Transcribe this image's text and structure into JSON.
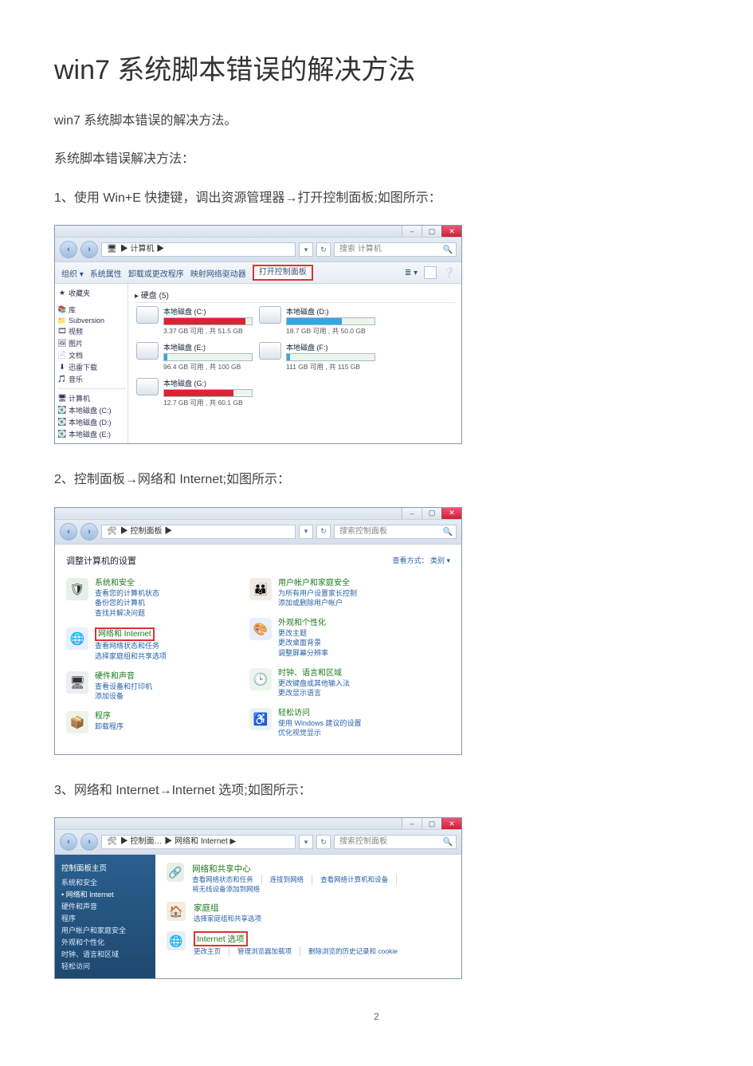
{
  "article": {
    "title": "win7 系统脚本错误的解决方法",
    "intro": "win7 系统脚本错误的解决方法。",
    "sub": "系统脚本错误解决方法：",
    "step1": "1、使用 Win+E 快捷键，调出资源管理器→打开控制面板;如图所示：",
    "step2": "2、控制面板→网络和 Internet;如图所示：",
    "step3": "3、网络和 Internet→Internet  选项;如图所示：",
    "page": "2"
  },
  "win_common": {
    "min": "–",
    "max": "▢",
    "close": "✕",
    "search_icon": "🔍",
    "back": "‹",
    "fwd": "›"
  },
  "img1": {
    "address": "▶  计算机  ▶",
    "search_placeholder": "搜索 计算机",
    "toolbar": {
      "a": "组织 ▾",
      "b": "系统属性",
      "c": "卸载或更改程序",
      "d": "映射网络驱动器",
      "e": "打开控制面板"
    },
    "side": {
      "fav": "收藏夹",
      "items": [
        "库",
        "Subversion",
        "视频",
        "图片",
        "文档",
        "迅雷下载",
        "音乐"
      ],
      "sep": "计算机",
      "bottom": [
        "本地磁盘 (C:)",
        "本地磁盘 (D:)",
        "本地磁盘 (E:)"
      ]
    },
    "main_header": "▸ 硬盘 (5)",
    "drives": [
      {
        "name": "本地磁盘 (C:)",
        "sub": "3.37 GB 可用 , 共 51.5 GB",
        "pct": 93,
        "red": true
      },
      {
        "name": "本地磁盘 (D:)",
        "sub": "18.7 GB 可用 , 共 50.0 GB",
        "pct": 63,
        "red": false
      },
      {
        "name": "本地磁盘 (E:)",
        "sub": "96.4 GB 可用 , 共 100 GB",
        "pct": 4,
        "red": false
      },
      {
        "name": "本地磁盘 (F:)",
        "sub": "111 GB 可用 , 共 115 GB",
        "pct": 4,
        "red": false
      },
      {
        "name": "本地磁盘 (G:)",
        "sub": "12.7 GB 可用 , 共 60.1 GB",
        "pct": 79,
        "red": true
      }
    ]
  },
  "img2": {
    "address": "▶ 控制面板 ▶",
    "search_placeholder": "搜索控制面板",
    "heading": "调整计算机的设置",
    "view": "查看方式：  类别 ▾",
    "left": [
      {
        "icon": "🛡",
        "bg": "#e5f0e9",
        "head": "系统和安全",
        "subs": [
          "查看您的计算机状态",
          "备份您的计算机",
          "查找并解决问题"
        ]
      },
      {
        "icon": "🌐",
        "bg": "#e8f0fb",
        "head": "网络和 Internet",
        "subs": [
          "查看网络状态和任务",
          "选择家庭组和共享选项"
        ],
        "highlight": true
      },
      {
        "icon": "🖥",
        "bg": "#eceef3",
        "head": "硬件和声音",
        "subs": [
          "查看设备和打印机",
          "添加设备"
        ]
      },
      {
        "icon": "📦",
        "bg": "#edf3e8",
        "head": "程序",
        "subs": [
          "卸载程序"
        ]
      }
    ],
    "right": [
      {
        "icon": "👪",
        "bg": "#f3ece6",
        "head": "用户帐户和家庭安全",
        "subs": [
          "为所有用户设置家长控制",
          "添加或删除用户帐户"
        ]
      },
      {
        "icon": "🎨",
        "bg": "#e8eefb",
        "head": "外观和个性化",
        "subs": [
          "更改主题",
          "更改桌面背景",
          "调整屏幕分辨率"
        ]
      },
      {
        "icon": "🕒",
        "bg": "#ecf4ec",
        "head": "时钟、语言和区域",
        "subs": [
          "更改键盘或其他输入法",
          "更改显示语言"
        ]
      },
      {
        "icon": "♿",
        "bg": "#eaf2f8",
        "head": "轻松访问",
        "subs": [
          "使用 Windows 建议的设置",
          "优化视觉显示"
        ]
      }
    ]
  },
  "img3": {
    "address": "▶ 控制面… ▶ 网络和 Internet ▶",
    "search_placeholder": "搜索控制面板",
    "side_head": "控制面板主页",
    "side_items": [
      "系统和安全",
      "网络和 Internet",
      "硬件和声音",
      "程序",
      "用户帐户和家庭安全",
      "外观和个性化",
      "时钟、语言和区域",
      "轻松访问"
    ],
    "side_current_index": 1,
    "items": [
      {
        "icon": "🔗",
        "bg": "#e6f0e6",
        "head": "网络和共享中心",
        "subs": [
          "查看网络状态和任务",
          "连接到网络",
          "查看网络计算机和设备",
          "将无线设备添加到网络"
        ]
      },
      {
        "icon": "🏠",
        "bg": "#f2eedf",
        "head": "家庭组",
        "subs": [
          "选择家庭组和共享选项"
        ]
      },
      {
        "icon": "🌐",
        "bg": "#e8eef5",
        "head": "Internet 选项",
        "highlight": true,
        "subs": [
          "更改主页",
          "管理浏览器加载项",
          "删除浏览的历史记录和 cookie"
        ]
      }
    ]
  }
}
